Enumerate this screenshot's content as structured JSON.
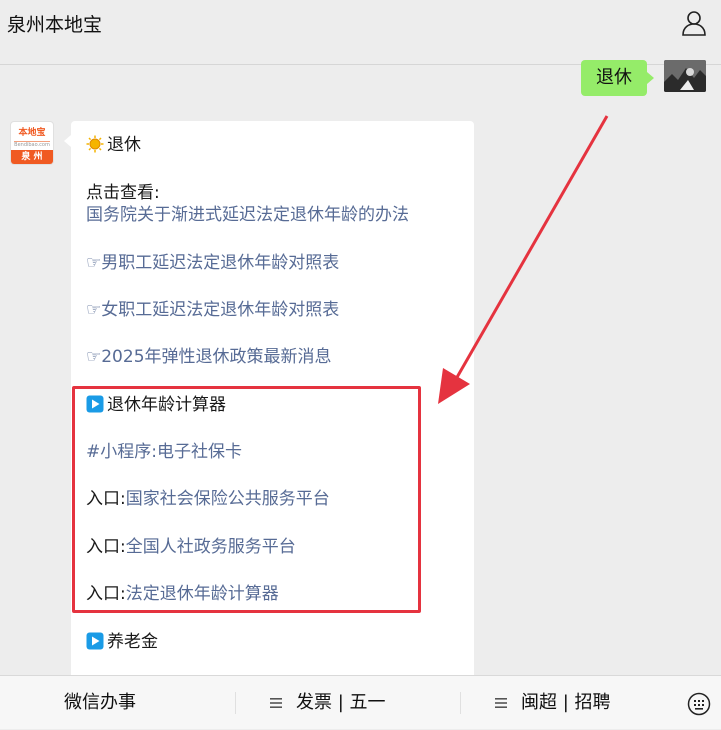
{
  "header": {
    "title": "泉州本地宝",
    "user_icon": "person-icon"
  },
  "sent": {
    "text": "退休"
  },
  "bot": {
    "avatar": {
      "top": "本地宝",
      "mid": "Bendibao.com",
      "bottom": "泉 州"
    },
    "lines": [
      {
        "icon": "sun-icon",
        "text": "退休",
        "style": "plain"
      },
      {
        "icon": "",
        "text": "点击查看:",
        "style": "plain"
      },
      {
        "icon": "",
        "text": "国务院关于渐进式延迟法定退休年龄的办法",
        "style": "link"
      },
      {
        "icon": "",
        "text": "☞男职工延迟法定退休年龄对照表",
        "style": "link"
      },
      {
        "icon": "",
        "text": "☞女职工延迟法定退休年龄对照表",
        "style": "link"
      },
      {
        "icon": "",
        "text": "☞2025年弹性退休政策最新消息",
        "style": "link"
      },
      {
        "icon": "play-icon",
        "text": "退休年龄计算器",
        "style": "plain"
      },
      {
        "icon": "",
        "text": "#小程序:电子社保卡",
        "style": "link"
      },
      {
        "icon": "",
        "prefix": "入口:",
        "text": "国家社会保险公共服务平台",
        "style": "link"
      },
      {
        "icon": "",
        "prefix": "入口:",
        "text": "全国人社政务服务平台",
        "style": "link"
      },
      {
        "icon": "",
        "prefix": "入口:",
        "text": "法定退休年龄计算器",
        "style": "link"
      },
      {
        "icon": "play-icon",
        "text": "养老金",
        "style": "plain"
      }
    ]
  },
  "bottom_menu": {
    "items": [
      {
        "label": "微信办事"
      },
      {
        "label": "发票 | 五一"
      },
      {
        "label": "闽超 | 招聘"
      }
    ],
    "keyboard_icon": "keyboard-icon"
  },
  "colors": {
    "link": "#576b95",
    "sent_bubble": "#95ec69",
    "highlight": "#e5333f"
  }
}
